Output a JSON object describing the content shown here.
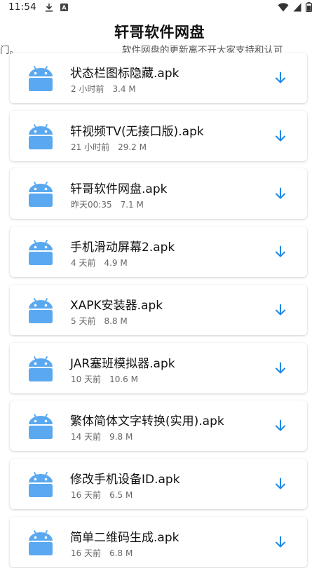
{
  "status_bar": {
    "time": "11:54",
    "icons_left": [
      "download-icon",
      "a-badge-icon"
    ],
    "icons_right": [
      "wifi-icon",
      "signal-icon",
      "battery-icon"
    ]
  },
  "header": {
    "title": "轩哥软件网盘",
    "marquee_left": "门。",
    "marquee_right": "软件网盘的更新离不开大家支持和认可"
  },
  "files": [
    {
      "name": "状态栏图标隐藏.apk",
      "time": "2 小时前",
      "size": "3.4 M"
    },
    {
      "name": "轩视频TV(无接口版).apk",
      "time": "21 小时前",
      "size": "29.2 M"
    },
    {
      "name": "轩哥软件网盘.apk",
      "time": "昨天00:35",
      "size": "7.1 M"
    },
    {
      "name": "手机滑动屏幕2.apk",
      "time": "4 天前",
      "size": "4.9 M"
    },
    {
      "name": "XAPK安装器.apk",
      "time": "5 天前",
      "size": "8.8 M"
    },
    {
      "name": "JAR塞班模拟器.apk",
      "time": "10 天前",
      "size": "10.6 M"
    },
    {
      "name": "繁体简体文字转换(实用).apk",
      "time": "14 天前",
      "size": "9.8 M"
    },
    {
      "name": "修改手机设备ID.apk",
      "time": "16 天前",
      "size": "6.5 M"
    },
    {
      "name": "简单二维码生成.apk",
      "time": "16 天前",
      "size": "6.8 M"
    }
  ],
  "colors": {
    "accent": "#1E88E5",
    "android_icon": "#5AA9F0"
  }
}
